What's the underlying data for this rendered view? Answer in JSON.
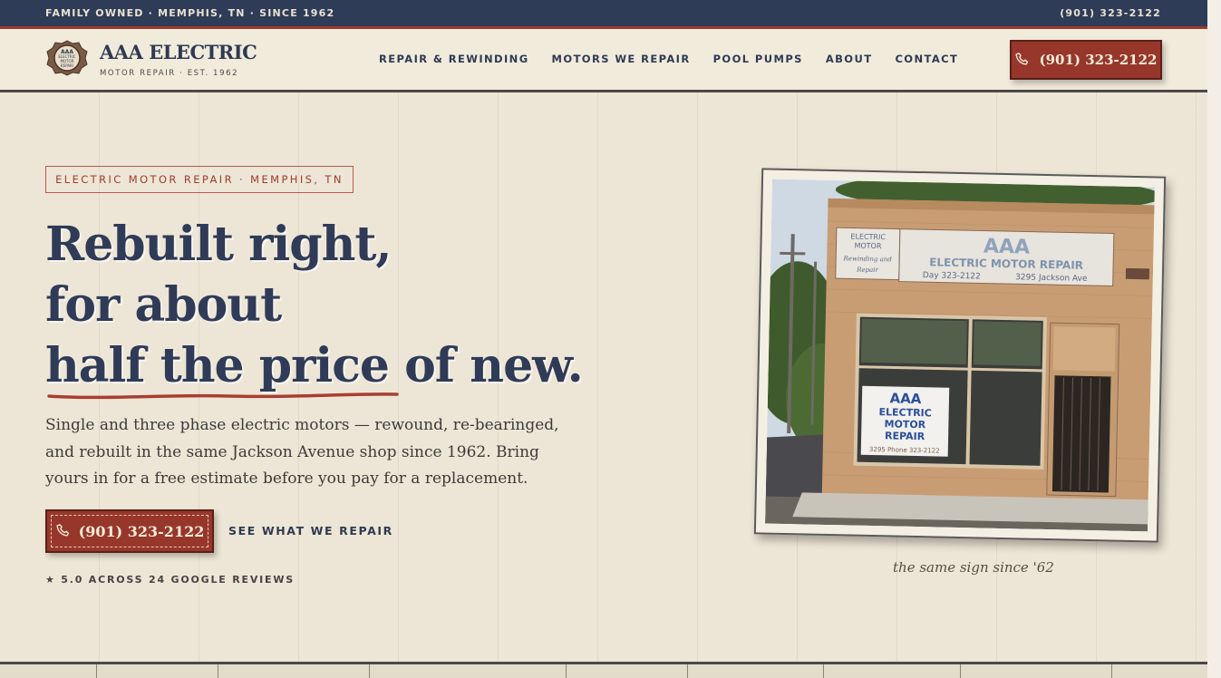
{
  "topbar": {
    "left_text": "FAMILY OWNED · MEMPHIS, TN · SINCE 1962",
    "phone": "(901) 323-2122"
  },
  "logo": {
    "name": "AAA ELECTRIC",
    "tagline": "MOTOR REPAIR · EST. 1962",
    "badge_lines": [
      "AAA",
      "ELECTRIC",
      "MOTOR",
      "REPAIR"
    ]
  },
  "nav": {
    "items": [
      {
        "label": "REPAIR & REWINDING"
      },
      {
        "label": "MOTORS WE REPAIR"
      },
      {
        "label": "POOL PUMPS"
      },
      {
        "label": "ABOUT"
      },
      {
        "label": "CONTACT"
      }
    ]
  },
  "header_cta": {
    "label": "(901) 323-2122",
    "icon": "phone-icon"
  },
  "hero": {
    "eyebrow": "ELECTRIC MOTOR REPAIR · MEMPHIS, TN",
    "headline_line1": "Rebuilt right,",
    "headline_line2": "for about",
    "headline_line3_emphasis": "half the price",
    "headline_line3_rest": " of new.",
    "subtext": "Single and three phase electric motors — rewound, re-bearinged, and rebuilt in the same Jackson Avenue shop since 1962. Bring yours in for a free estimate before you pay for a replacement.",
    "cta_phone": "(901) 323-2122",
    "cta_link": "SEE WHAT WE REPAIR",
    "reviews": "★ 5.0 ACROSS 24 GOOGLE REVIEWS"
  },
  "photo": {
    "sign_left": [
      "ELECTRIC",
      "MOTOR",
      "Rewinding and",
      "Repair"
    ],
    "sign_main_title": "AAA",
    "sign_main_sub": "ELECTRIC MOTOR REPAIR",
    "sign_main_day": "Day 323-2122",
    "sign_main_addr": "3295 Jackson Ave",
    "window_sign": [
      "AAA",
      "ELECTRIC",
      "MOTOR",
      "REPAIR"
    ],
    "window_sign_footer": "3295  Phone 323-2122",
    "caption": "the same sign since '62"
  },
  "colors": {
    "navy": "#2f3c58",
    "brick_red": "#97372b",
    "cream": "#ede6d6"
  }
}
